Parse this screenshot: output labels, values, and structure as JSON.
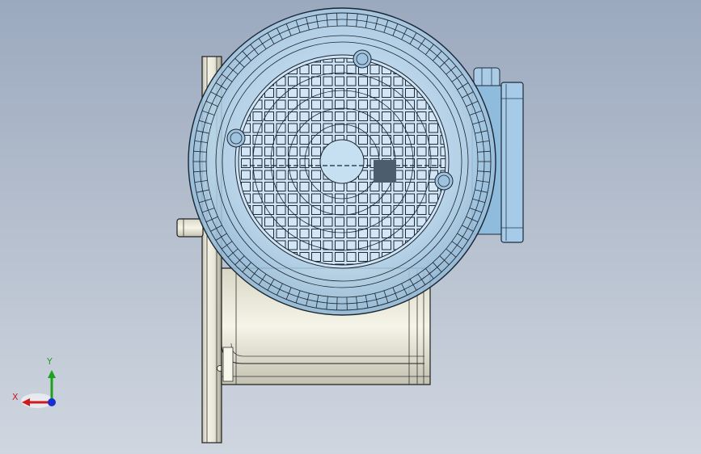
{
  "viewport": {
    "background_top": "#9ba9bf",
    "background_bottom": "#cfd6e0",
    "model": "motor-gearbox-assembly"
  },
  "triad": {
    "x_label": "X",
    "y_label": "Y",
    "x_color": "#d11b1b",
    "y_color": "#20a020",
    "z_color": "#1b2fd1"
  }
}
